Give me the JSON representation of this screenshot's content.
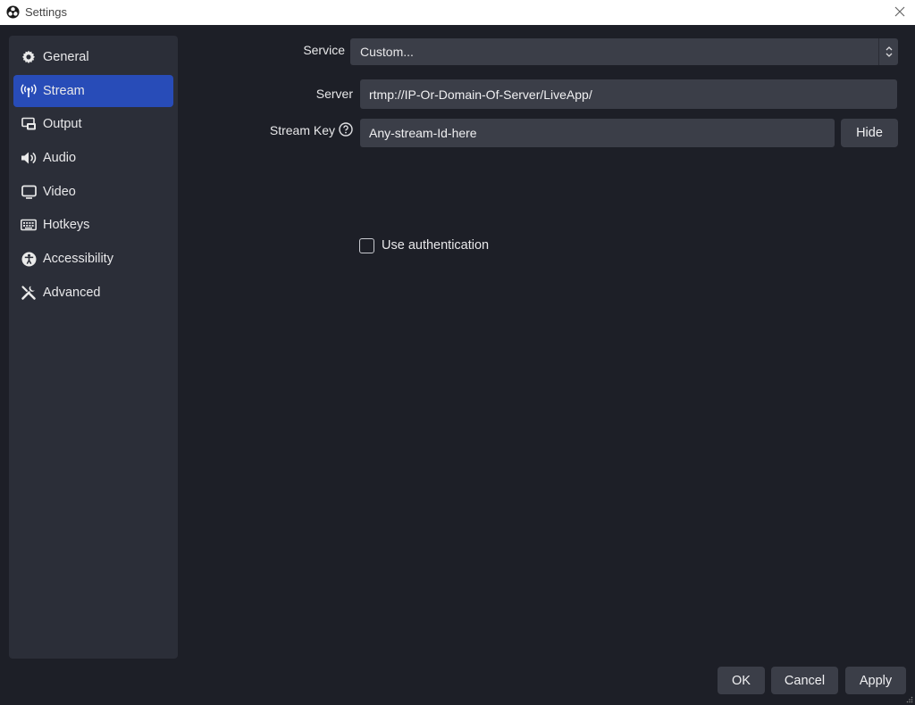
{
  "window": {
    "title": "Settings",
    "close_icon": "close-icon",
    "app_icon": "obs-logo-icon"
  },
  "sidebar": {
    "items": [
      {
        "label": "General",
        "icon": "gear-icon",
        "active": false
      },
      {
        "label": "Stream",
        "icon": "antenna-icon",
        "active": true
      },
      {
        "label": "Output",
        "icon": "output-icon",
        "active": false
      },
      {
        "label": "Audio",
        "icon": "speaker-icon",
        "active": false
      },
      {
        "label": "Video",
        "icon": "monitor-icon",
        "active": false
      },
      {
        "label": "Hotkeys",
        "icon": "keyboard-icon",
        "active": false
      },
      {
        "label": "Accessibility",
        "icon": "accessibility-icon",
        "active": false
      },
      {
        "label": "Advanced",
        "icon": "tools-icon",
        "active": false
      }
    ]
  },
  "stream": {
    "service_label": "Service",
    "service_value": "Custom...",
    "server_label": "Server",
    "server_value": "rtmp://IP-Or-Domain-Of-Server/LiveApp/",
    "stream_key_label": "Stream Key",
    "stream_key_value": "Any-stream-Id-here",
    "hide_label": "Hide",
    "use_auth_label": "Use authentication",
    "use_auth_checked": false
  },
  "footer": {
    "ok_label": "OK",
    "cancel_label": "Cancel",
    "apply_label": "Apply"
  },
  "colors": {
    "background": "#1d1f27",
    "sidebar": "#2b2e38",
    "active": "#284cb8",
    "field": "#3b3e48"
  }
}
